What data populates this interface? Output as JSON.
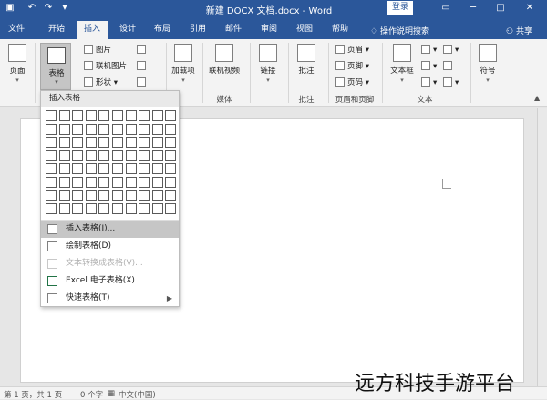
{
  "titlebar": {
    "title": "新建 DOCX 文档.docx - Word",
    "login": "登录",
    "save_icon": "save-icon",
    "undo_icon": "undo-icon",
    "redo_icon": "redo-icon"
  },
  "tabs": [
    "文件",
    "开始",
    "插入",
    "设计",
    "布局",
    "引用",
    "邮件",
    "审阅",
    "视图",
    "帮助"
  ],
  "active_tab": "插入",
  "tellme": "操作说明搜索",
  "share": "共享",
  "ribbon": {
    "pages": "页面",
    "table": "表格",
    "pictures": "图片",
    "online_pictures": "联机图片",
    "shapes": "形状",
    "addins": "加载项",
    "online_video": "联机视频",
    "link": "链接",
    "comment": "批注",
    "header": "页眉",
    "footer": "页脚",
    "page_number": "页码",
    "textbox": "文本框",
    "symbol": "符号",
    "groups": {
      "media": "媒体",
      "comments": "批注",
      "header_footer": "页眉和页脚",
      "text": "文本"
    }
  },
  "dropdown": {
    "header": "插入表格",
    "items": [
      {
        "label": "插入表格(I)...",
        "state": "highlighted"
      },
      {
        "label": "绘制表格(D)",
        "state": "normal"
      },
      {
        "label": "文本转换成表格(V)...",
        "state": "disabled"
      },
      {
        "label": "Excel 电子表格(X)",
        "state": "normal"
      },
      {
        "label": "快速表格(T)",
        "state": "normal",
        "submenu": true
      }
    ]
  },
  "statusbar": {
    "page": "第 1 页，共 1 页",
    "words": "0 个字",
    "language": "中文(中国)"
  },
  "watermark": "远方科技手游平台",
  "colors": {
    "accent": "#2b579a",
    "ribbon": "#f3f3f3",
    "doc_bg": "#e6e6e6"
  }
}
